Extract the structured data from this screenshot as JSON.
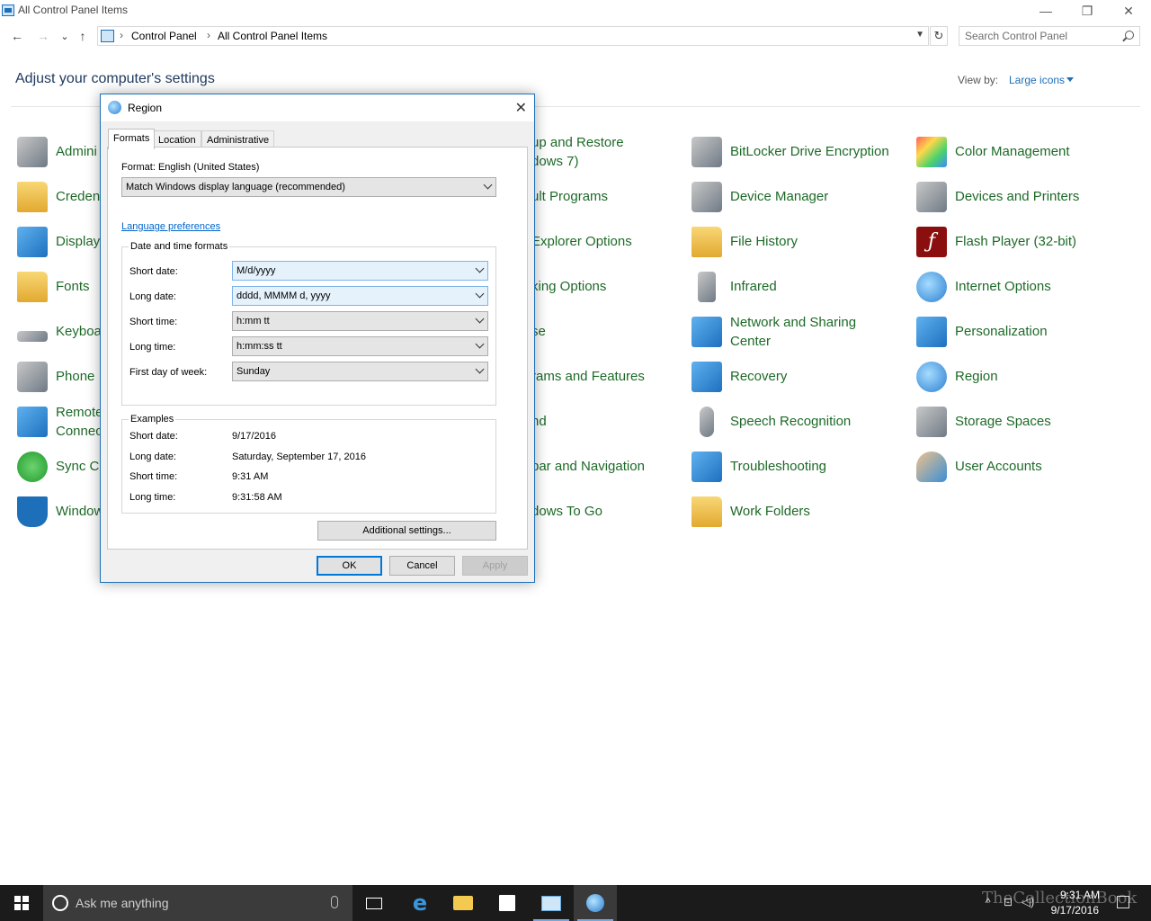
{
  "window": {
    "title": "All Control Panel Items",
    "minimize_glyph": "—",
    "restore_glyph": "❐",
    "close_glyph": "✕"
  },
  "nav": {
    "back_glyph": "←",
    "forward_glyph": "→",
    "recent_glyph": "⌄",
    "up_glyph": "↑",
    "breadcrumb": [
      "Control Panel",
      "All Control Panel Items"
    ],
    "refresh_glyph": "↻",
    "search_placeholder": "Search Control Panel"
  },
  "header": {
    "title": "Adjust your computer's settings",
    "view_by_label": "View by:",
    "view_by_value": "Large icons"
  },
  "items": {
    "col1": [
      {
        "label": "Admini",
        "icon": "administrative-tools-icon"
      },
      {
        "label": "Creden",
        "icon": "credential-manager-icon"
      },
      {
        "label": "Display",
        "icon": "display-icon"
      },
      {
        "label": "Fonts",
        "icon": "fonts-icon"
      },
      {
        "label": "Keyboa",
        "icon": "keyboard-icon"
      },
      {
        "label": "Phone",
        "icon": "phone-icon"
      },
      {
        "label": "Remote\nConnec",
        "icon": "remote-connections-icon"
      },
      {
        "label": "Sync Cc",
        "icon": "sync-center-icon"
      },
      {
        "label": "Window",
        "icon": "windows-defender-icon"
      }
    ],
    "col2": [
      {
        "label": "up and Restore\ndows 7)"
      },
      {
        "label": "ult Programs"
      },
      {
        "label": "Explorer Options"
      },
      {
        "label": "king Options"
      },
      {
        "label": "se"
      },
      {
        "label": "rams and Features"
      },
      {
        "label": "nd"
      },
      {
        "label": "bar and Navigation"
      },
      {
        "label": "dows To Go"
      }
    ],
    "col3": [
      {
        "label": "BitLocker Drive Encryption",
        "icon": "bitlocker-icon"
      },
      {
        "label": "Device Manager",
        "icon": "device-manager-icon"
      },
      {
        "label": "File History",
        "icon": "file-history-icon"
      },
      {
        "label": "Infrared",
        "icon": "infrared-icon"
      },
      {
        "label": "Network and Sharing\nCenter",
        "icon": "network-sharing-icon"
      },
      {
        "label": "Recovery",
        "icon": "recovery-icon"
      },
      {
        "label": "Speech Recognition",
        "icon": "speech-recognition-icon"
      },
      {
        "label": "Troubleshooting",
        "icon": "troubleshooting-icon"
      },
      {
        "label": "Work Folders",
        "icon": "work-folders-icon"
      }
    ],
    "col4": [
      {
        "label": "Color Management",
        "icon": "color-management-icon"
      },
      {
        "label": "Devices and Printers",
        "icon": "devices-printers-icon"
      },
      {
        "label": "Flash Player (32-bit)",
        "icon": "flash-player-icon"
      },
      {
        "label": "Internet Options",
        "icon": "internet-options-icon"
      },
      {
        "label": "Personalization",
        "icon": "personalization-icon"
      },
      {
        "label": "Region",
        "icon": "region-icon"
      },
      {
        "label": "Storage Spaces",
        "icon": "storage-spaces-icon"
      },
      {
        "label": "User Accounts",
        "icon": "user-accounts-icon"
      }
    ]
  },
  "dialog": {
    "title": "Region",
    "close_glyph": "✕",
    "tabs": [
      "Formats",
      "Location",
      "Administrative"
    ],
    "format_label": "Format: English (United States)",
    "format_value": "Match Windows display language (recommended)",
    "language_link": "Language preferences",
    "dt_group": "Date and time formats",
    "fields": [
      {
        "label": "Short date:",
        "value": "M/d/yyyy"
      },
      {
        "label": "Long date:",
        "value": "dddd, MMMM d, yyyy"
      },
      {
        "label": "Short time:",
        "value": "h:mm tt"
      },
      {
        "label": "Long time:",
        "value": "h:mm:ss tt"
      },
      {
        "label": "First day of week:",
        "value": "Sunday"
      }
    ],
    "examples_group": "Examples",
    "examples": [
      {
        "label": "Short date:",
        "value": "9/17/2016"
      },
      {
        "label": "Long date:",
        "value": "Saturday, September 17, 2016"
      },
      {
        "label": "Short time:",
        "value": "9:31 AM"
      },
      {
        "label": "Long time:",
        "value": "9:31:58 AM"
      }
    ],
    "additional_settings": "Additional settings...",
    "ok": "OK",
    "cancel": "Cancel",
    "apply": "Apply"
  },
  "taskbar": {
    "cortana_placeholder": "Ask me anything",
    "time": "9:31 AM",
    "date": "9/17/2016",
    "watermark": "TheCollectionBook"
  }
}
